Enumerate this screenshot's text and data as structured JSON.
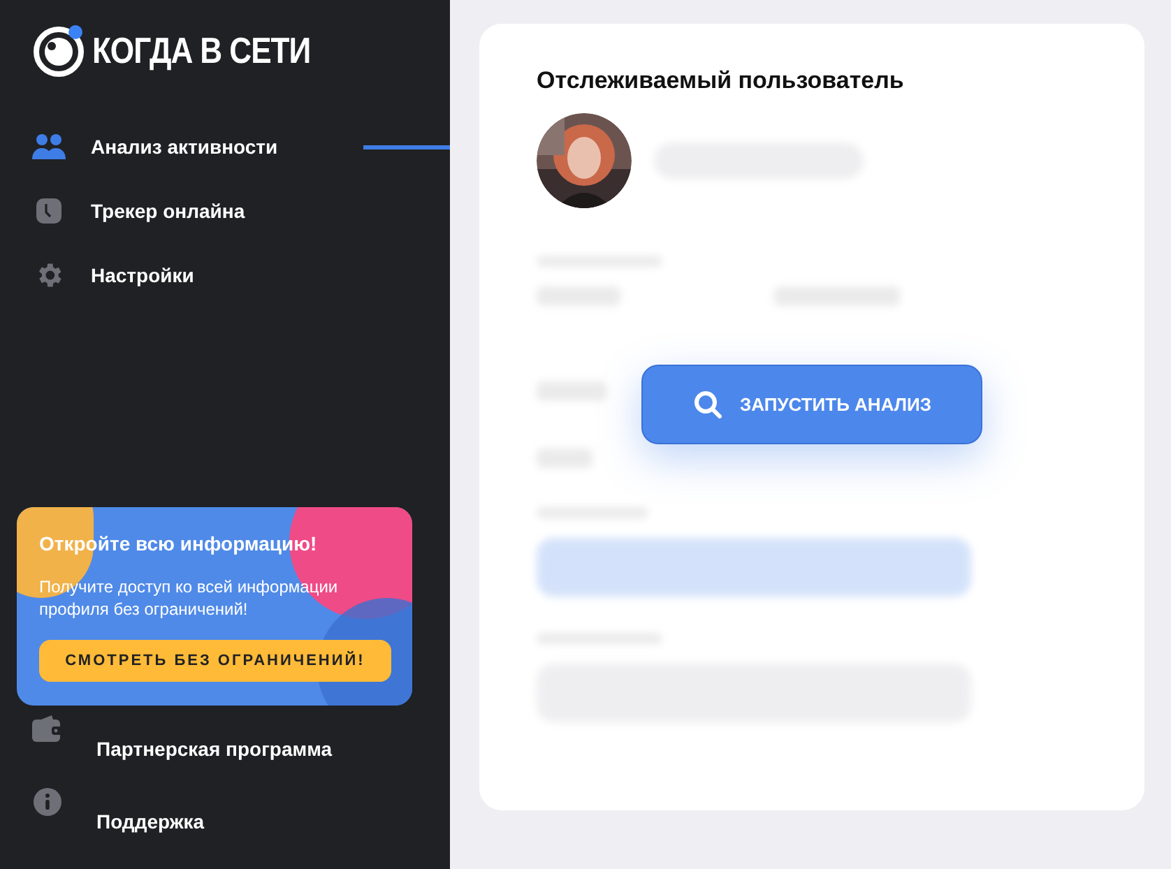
{
  "logo": {
    "text": "КОГДА В СЕТИ"
  },
  "nav": [
    {
      "label": "Анализ активности",
      "selected": true
    },
    {
      "label": "Трекер онлайна",
      "selected": false
    },
    {
      "label": "Настройки",
      "selected": false
    }
  ],
  "promo": {
    "title": "Откройте всю информацию!",
    "text": "Получите доступ ко всей информации профиля без ограничений!",
    "button": "СМОТРЕТЬ БЕЗ ОГРАНИЧЕНИЙ!"
  },
  "bottom_nav": [
    {
      "label": "Партнерская программа"
    },
    {
      "label": "Поддержка"
    }
  ],
  "main": {
    "title": "Отслеживаемый пользователь",
    "analyze_button": "ЗАПУСТИТЬ АНАЛИЗ"
  }
}
